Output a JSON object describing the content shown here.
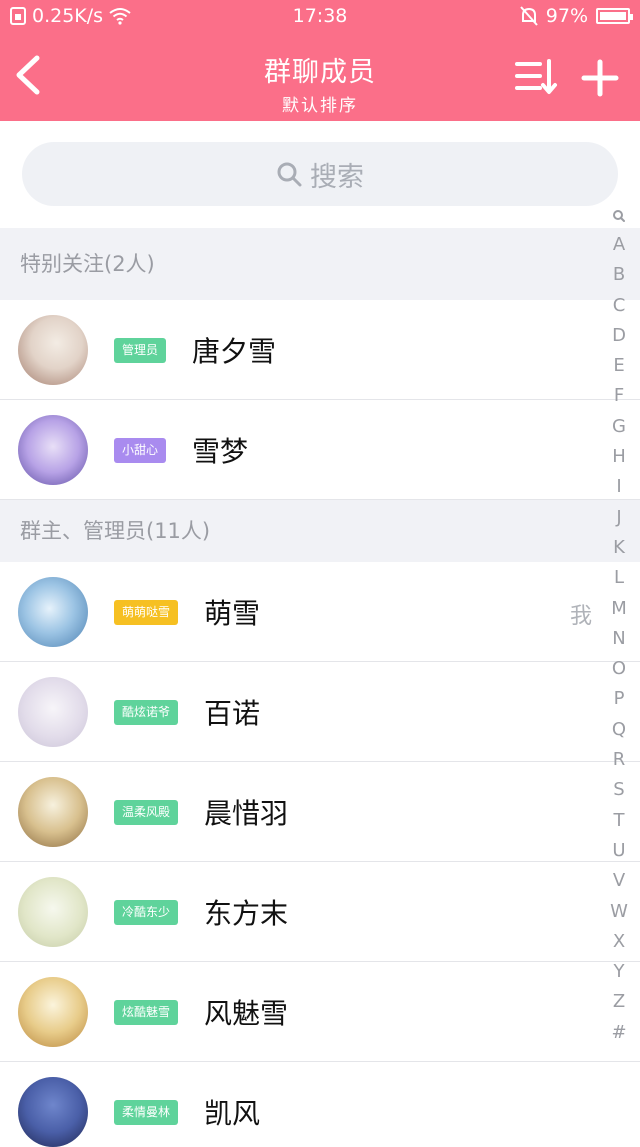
{
  "status_bar": {
    "speed": "0.25K/s",
    "time": "17:38",
    "battery": "97%"
  },
  "header": {
    "title": "群聊成员",
    "subtitle": "默认排序"
  },
  "search": {
    "placeholder": "搜索"
  },
  "sections": [
    {
      "label": "特别关注(2人)"
    },
    {
      "label": "群主、管理员(11人)"
    }
  ],
  "members": [
    {
      "badge": "管理员",
      "badge_color": "#5fd39b",
      "name": "唐夕雪",
      "avatar_colors": [
        "#f3ece4",
        "#a17a6a"
      ]
    },
    {
      "badge": "小甜心",
      "badge_color": "#a98bef",
      "name": "雪梦",
      "avatar_colors": [
        "#d9c6f0",
        "#5a4aa0"
      ]
    },
    {
      "badge": "萌萌哒雪",
      "badge_color": "#f6c022",
      "name": "萌雪",
      "me": "我",
      "avatar_colors": [
        "#bcd9ee",
        "#4a7fb0"
      ]
    },
    {
      "badge": "酷炫诺爷",
      "badge_color": "#5fd39b",
      "name": "百诺",
      "avatar_colors": [
        "#eeeaf2",
        "#c9c2d6"
      ]
    },
    {
      "badge": "温柔风殿",
      "badge_color": "#5fd39b",
      "name": "晨惜羽",
      "avatar_colors": [
        "#f0ead2",
        "#8a6a3e"
      ]
    },
    {
      "badge": "冷酷东少",
      "badge_color": "#5fd39b",
      "name": "东方末",
      "avatar_colors": [
        "#eef2df",
        "#c2c9a3"
      ]
    },
    {
      "badge": "炫酷魅雪",
      "badge_color": "#5fd39b",
      "name": "风魅雪",
      "avatar_colors": [
        "#f5ecd0",
        "#b8863c"
      ]
    },
    {
      "badge": "柔情曼林",
      "badge_color": "#5fd39b",
      "name": "凯风",
      "avatar_colors": [
        "#4a5fa8",
        "#1e2550"
      ]
    }
  ],
  "index_letters": [
    "A",
    "B",
    "C",
    "D",
    "E",
    "F",
    "G",
    "H",
    "I",
    "J",
    "K",
    "L",
    "M",
    "N",
    "O",
    "P",
    "Q",
    "R",
    "S",
    "T",
    "U",
    "V",
    "W",
    "X",
    "Y",
    "Z",
    "#"
  ]
}
